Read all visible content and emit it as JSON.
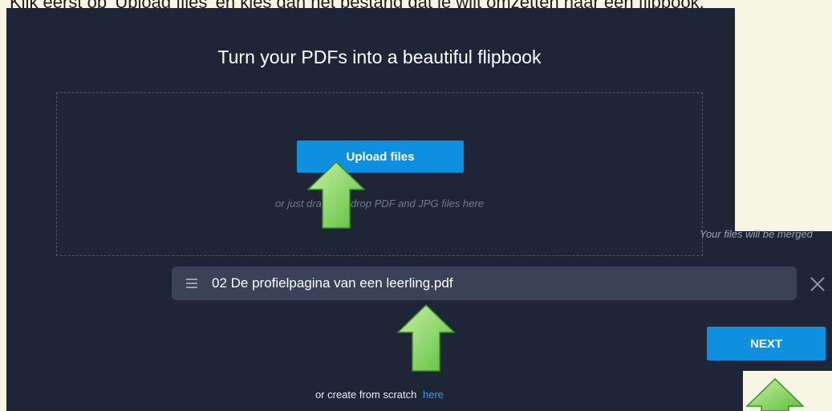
{
  "top_caption": "Klik eerst op 'Upload files' en kies dan het bestand dat je wilt omzetten naar een flipbook.",
  "title": "Turn your PDFs into a beautiful flipbook",
  "upload_button": "Upload files",
  "drop_hint": "or just drag and drop PDF and JPG files here",
  "merge_note": "Your files will be merged",
  "files": [
    {
      "name": "02 De profielpagina van een leerling.pdf"
    }
  ],
  "next_button": "NEXT",
  "scratch": {
    "text": "or create from scratch",
    "link": "here"
  },
  "colors": {
    "panel": "#1d2537",
    "accent": "#0f8fe0",
    "file_row": "#3a4257",
    "annotation_arrow": "#7ed35a",
    "background": "#f7f6e4"
  },
  "icons": [
    "drag-handle-icon",
    "close-icon",
    "arrow-up-icon"
  ]
}
